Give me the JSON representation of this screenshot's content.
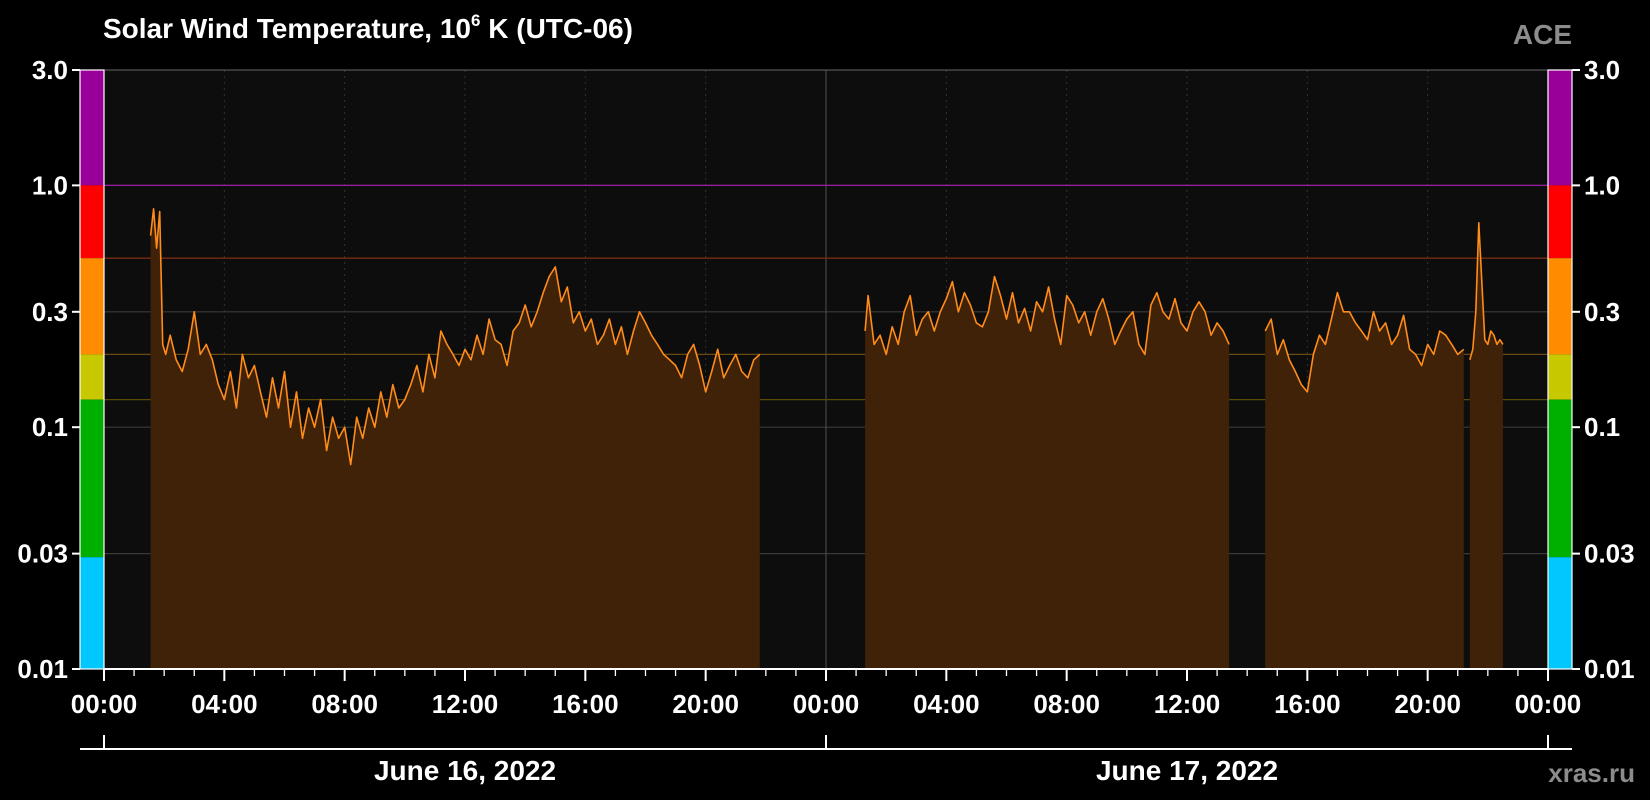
{
  "chart_data": {
    "type": "area",
    "title": "Solar Wind Temperature, 10",
    "title_sup": "6",
    "title_tail": " K (UTC-06)",
    "brand": "ACE",
    "credit": "xras.ru",
    "y_scale": "log",
    "ylim": [
      0.01,
      3.0
    ],
    "y_ticks": [
      {
        "value": 3.0,
        "label": "3.0"
      },
      {
        "value": 1.0,
        "label": "1.0"
      },
      {
        "value": 0.3,
        "label": "0.3"
      },
      {
        "value": 0.1,
        "label": "0.1"
      },
      {
        "value": 0.03,
        "label": "0.03"
      },
      {
        "value": 0.01,
        "label": "0.01"
      }
    ],
    "x_unit": "hours since 2022-06-16 00:00 (UTC-06)",
    "xlim": [
      0,
      48
    ],
    "x_ticks": [
      {
        "value": 0,
        "label": "00:00"
      },
      {
        "value": 4,
        "label": "04:00"
      },
      {
        "value": 8,
        "label": "08:00"
      },
      {
        "value": 12,
        "label": "12:00"
      },
      {
        "value": 16,
        "label": "16:00"
      },
      {
        "value": 20,
        "label": "20:00"
      },
      {
        "value": 24,
        "label": "00:00"
      },
      {
        "value": 28,
        "label": "04:00"
      },
      {
        "value": 32,
        "label": "08:00"
      },
      {
        "value": 36,
        "label": "12:00"
      },
      {
        "value": 40,
        "label": "16:00"
      },
      {
        "value": 44,
        "label": "20:00"
      },
      {
        "value": 48,
        "label": "00:00"
      }
    ],
    "dates": [
      {
        "label": "June 16, 2022",
        "center": 12
      },
      {
        "label": "June 17, 2022",
        "center": 36
      }
    ],
    "scale_bands": [
      {
        "from": 1.0,
        "to": 3.0,
        "color": "#990099"
      },
      {
        "from": 0.5,
        "to": 1.0,
        "color": "#ff0000"
      },
      {
        "from": 0.2,
        "to": 0.5,
        "color": "#ff8c00"
      },
      {
        "from": 0.13,
        "to": 0.2,
        "color": "#c8c800"
      },
      {
        "from": 0.029,
        "to": 0.13,
        "color": "#00b000"
      },
      {
        "from": 0.01,
        "to": 0.029,
        "color": "#00c8ff"
      }
    ],
    "threshold_lines": [
      {
        "value": 1.0,
        "color": "#9a1aa0"
      },
      {
        "value": 0.5,
        "color": "#7a2a10"
      },
      {
        "value": 0.2,
        "color": "#6a4a10"
      },
      {
        "value": 0.13,
        "color": "#5a4a08"
      }
    ],
    "colors": {
      "line": "#ff8c1a",
      "fill": "#3f2208",
      "plot_bg": "#0d0d0d",
      "grid": "#3a3a3a"
    },
    "series": [
      {
        "segments": [
          {
            "x": [
              1.55,
              1.65,
              1.75,
              1.85,
              1.95,
              2.05,
              2.2,
              2.4,
              2.6,
              2.8,
              3.0,
              3.2,
              3.4,
              3.6,
              3.8,
              4.0,
              4.2,
              4.4,
              4.6,
              4.8,
              5.0,
              5.2,
              5.4,
              5.6,
              5.8,
              6.0,
              6.2,
              6.4,
              6.6,
              6.8,
              7.0,
              7.2,
              7.4,
              7.6,
              7.8,
              8.0,
              8.2,
              8.4,
              8.6,
              8.8,
              9.0,
              9.2,
              9.4,
              9.6,
              9.8,
              10.0,
              10.2,
              10.4,
              10.6,
              10.8,
              11.0,
              11.2,
              11.4,
              11.6,
              11.8,
              12.0,
              12.2,
              12.4,
              12.6,
              12.8,
              13.0,
              13.2,
              13.4,
              13.6,
              13.8,
              14.0,
              14.2,
              14.4,
              14.6,
              14.8,
              15.0,
              15.2,
              15.4,
              15.6,
              15.8,
              16.0,
              16.2,
              16.4,
              16.6,
              16.8,
              17.0,
              17.2,
              17.4,
              17.6,
              17.8,
              18.0,
              18.2,
              18.4,
              18.6,
              18.8,
              19.0,
              19.2,
              19.4,
              19.6,
              19.8,
              20.0,
              20.2,
              20.4,
              20.6,
              20.8,
              21.0,
              21.2,
              21.4,
              21.6,
              21.8
            ],
            "y": [
              0.62,
              0.8,
              0.55,
              0.78,
              0.22,
              0.2,
              0.24,
              0.19,
              0.17,
              0.21,
              0.3,
              0.2,
              0.22,
              0.19,
              0.15,
              0.13,
              0.17,
              0.12,
              0.2,
              0.16,
              0.18,
              0.14,
              0.11,
              0.16,
              0.12,
              0.17,
              0.1,
              0.14,
              0.09,
              0.12,
              0.1,
              0.13,
              0.08,
              0.11,
              0.09,
              0.1,
              0.07,
              0.11,
              0.09,
              0.12,
              0.1,
              0.14,
              0.11,
              0.15,
              0.12,
              0.13,
              0.15,
              0.18,
              0.14,
              0.2,
              0.16,
              0.25,
              0.22,
              0.2,
              0.18,
              0.21,
              0.19,
              0.24,
              0.2,
              0.28,
              0.23,
              0.22,
              0.18,
              0.25,
              0.27,
              0.32,
              0.26,
              0.3,
              0.36,
              0.42,
              0.46,
              0.33,
              0.38,
              0.27,
              0.3,
              0.25,
              0.28,
              0.22,
              0.24,
              0.28,
              0.22,
              0.26,
              0.2,
              0.25,
              0.3,
              0.27,
              0.24,
              0.22,
              0.2,
              0.19,
              0.18,
              0.16,
              0.2,
              0.22,
              0.18,
              0.14,
              0.17,
              0.21,
              0.16,
              0.18,
              0.2,
              0.17,
              0.16,
              0.19,
              0.2
            ]
          },
          {
            "x": [
              25.3,
              25.4,
              25.6,
              25.8,
              26.0,
              26.2,
              26.4,
              26.6,
              26.8,
              27.0,
              27.2,
              27.4,
              27.6,
              27.8,
              28.0,
              28.2,
              28.4,
              28.6,
              28.8,
              29.0,
              29.2,
              29.4,
              29.6,
              29.8,
              30.0,
              30.2,
              30.4,
              30.6,
              30.8,
              31.0,
              31.2,
              31.4,
              31.6,
              31.8,
              32.0,
              32.2,
              32.4,
              32.6,
              32.8,
              33.0,
              33.2,
              33.4,
              33.6,
              33.8,
              34.0,
              34.2,
              34.4,
              34.6,
              34.8,
              35.0,
              35.2,
              35.4,
              35.6,
              35.8,
              36.0,
              36.2,
              36.4,
              36.6,
              36.8,
              37.0,
              37.2,
              37.4
            ],
            "y": [
              0.25,
              0.35,
              0.22,
              0.24,
              0.2,
              0.26,
              0.22,
              0.3,
              0.35,
              0.24,
              0.28,
              0.3,
              0.25,
              0.3,
              0.34,
              0.4,
              0.3,
              0.36,
              0.32,
              0.27,
              0.26,
              0.3,
              0.42,
              0.35,
              0.28,
              0.36,
              0.27,
              0.31,
              0.25,
              0.33,
              0.3,
              0.38,
              0.28,
              0.22,
              0.35,
              0.32,
              0.27,
              0.3,
              0.24,
              0.3,
              0.34,
              0.28,
              0.22,
              0.25,
              0.28,
              0.3,
              0.22,
              0.2,
              0.32,
              0.36,
              0.3,
              0.28,
              0.34,
              0.27,
              0.25,
              0.3,
              0.33,
              0.3,
              0.24,
              0.27,
              0.25,
              0.22
            ]
          },
          {
            "x": [
              38.6,
              38.8,
              39.0,
              39.2,
              39.4,
              39.6,
              39.8,
              40.0,
              40.2,
              40.4,
              40.6,
              40.8,
              41.0,
              41.2,
              41.4,
              41.6,
              41.8,
              42.0,
              42.2,
              42.4,
              42.6,
              42.8,
              43.0,
              43.2,
              43.4,
              43.6,
              43.8,
              44.0,
              44.2,
              44.4,
              44.6,
              44.8,
              45.0,
              45.2
            ],
            "y": [
              0.25,
              0.28,
              0.2,
              0.23,
              0.19,
              0.17,
              0.15,
              0.14,
              0.2,
              0.24,
              0.22,
              0.28,
              0.36,
              0.3,
              0.3,
              0.27,
              0.25,
              0.23,
              0.3,
              0.25,
              0.27,
              0.22,
              0.24,
              0.29,
              0.21,
              0.2,
              0.18,
              0.22,
              0.2,
              0.25,
              0.24,
              0.22,
              0.2,
              0.21
            ]
          },
          {
            "x": [
              45.4,
              45.5,
              45.6,
              45.7,
              45.8,
              45.9,
              46.0,
              46.1,
              46.2,
              46.3,
              46.4,
              46.5
            ],
            "y": [
              0.19,
              0.21,
              0.3,
              0.7,
              0.4,
              0.23,
              0.22,
              0.25,
              0.24,
              0.22,
              0.23,
              0.22
            ]
          }
        ]
      }
    ]
  }
}
